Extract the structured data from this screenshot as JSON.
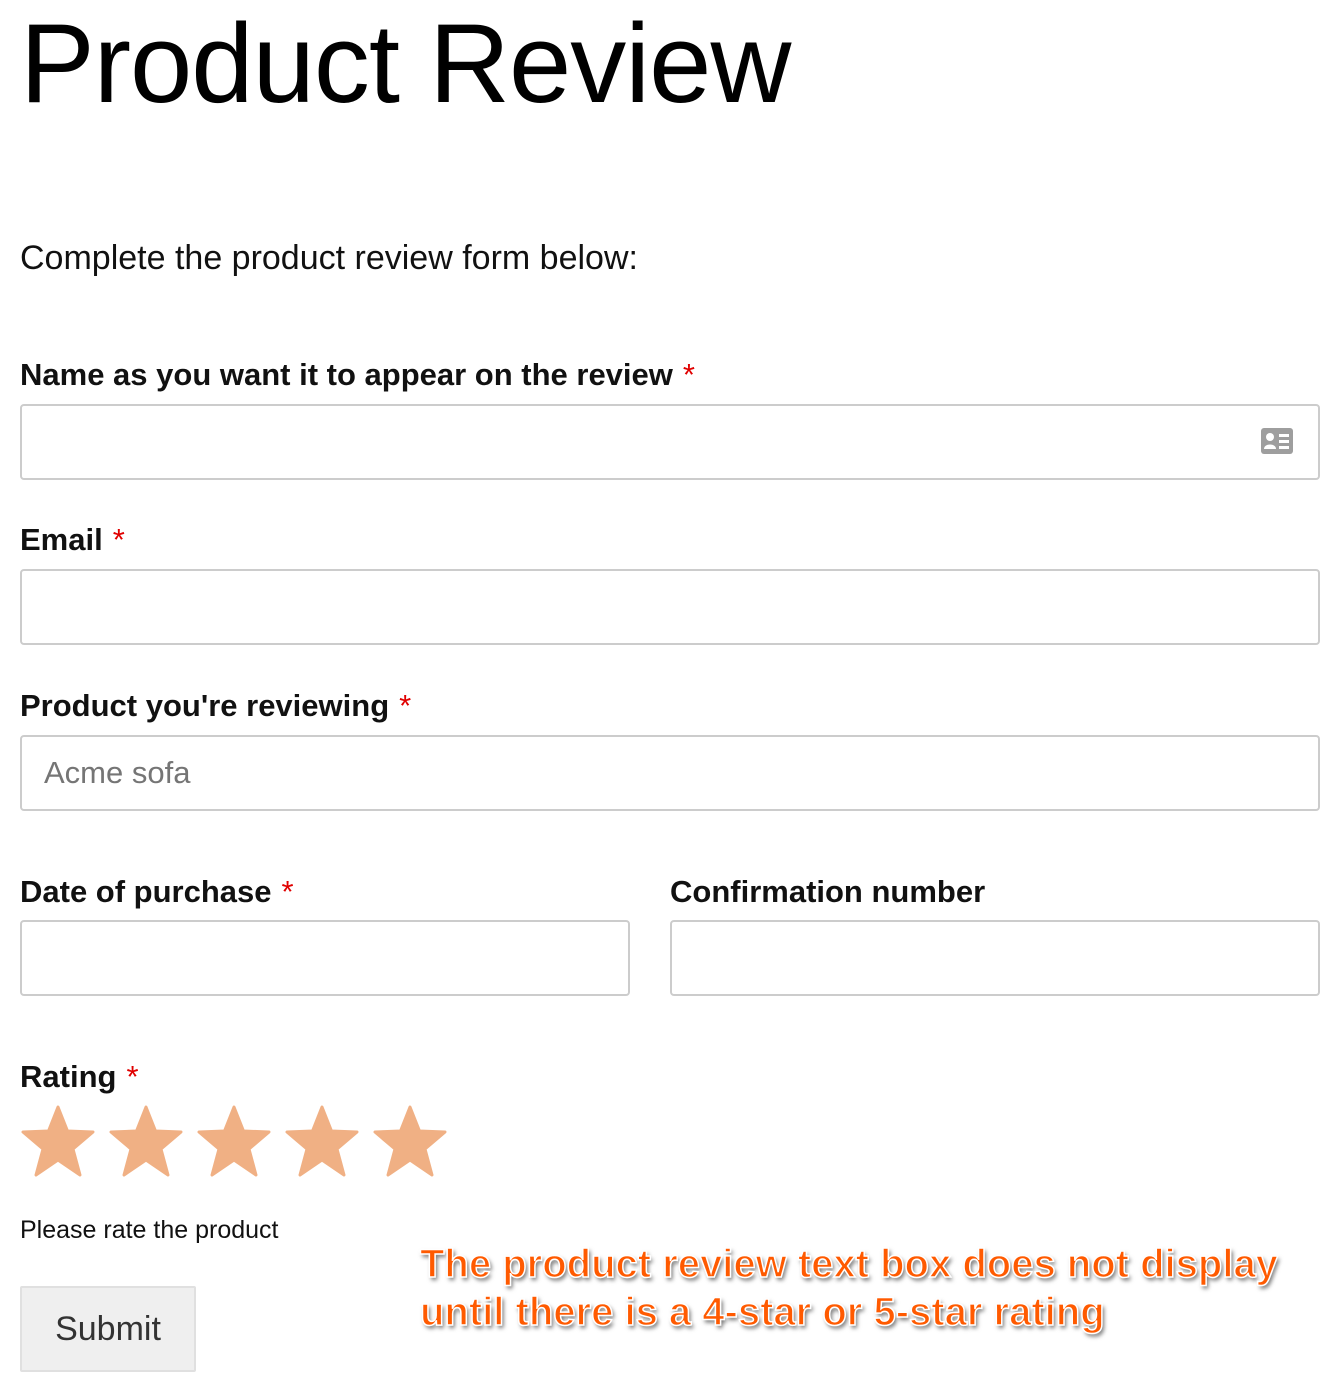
{
  "page": {
    "title": "Product Review",
    "intro": "Complete the product review form below:"
  },
  "form": {
    "required_marker": "*",
    "name_field": {
      "label": "Name as you want it to appear on the review",
      "value": "",
      "placeholder": "",
      "icon": "contact-card-icon"
    },
    "email_field": {
      "label": "Email",
      "value": "",
      "placeholder": ""
    },
    "product_field": {
      "label": "Product you're reviewing",
      "value": "",
      "placeholder": "Acme sofa"
    },
    "date_field": {
      "label": "Date of purchase",
      "value": "",
      "placeholder": ""
    },
    "confirmation_field": {
      "label": "Confirmation number",
      "value": "",
      "placeholder": ""
    },
    "rating": {
      "label": "Rating",
      "max_stars": 5,
      "selected": 0,
      "star_color": "#f0b084",
      "help_text": "Please rate the product"
    },
    "submit_label": "Submit"
  },
  "annotation": {
    "text": "The product review text box does not display until there is a 4-star or 5-star rating",
    "color": "#ff5a00"
  }
}
